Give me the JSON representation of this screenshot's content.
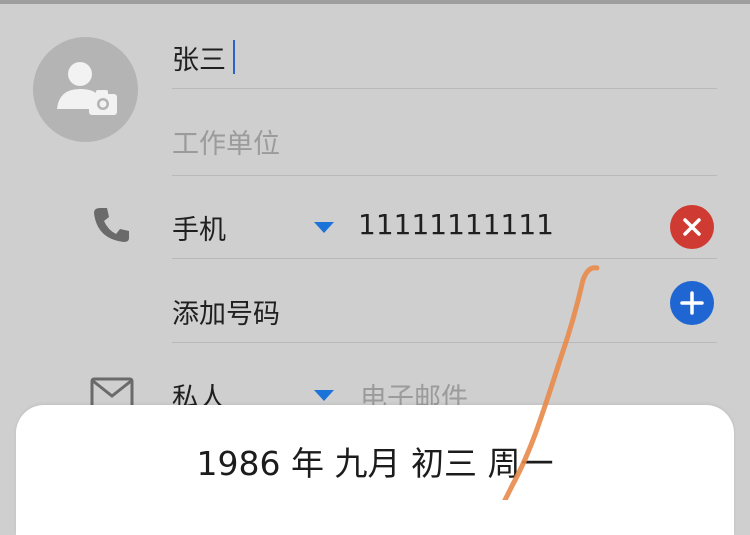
{
  "contact_form": {
    "name_value": "张三",
    "company_placeholder": "工作单位",
    "phone": {
      "type_label": "手机",
      "number": "11111111111"
    },
    "add_number_label": "添加号码",
    "email": {
      "type_label": "私人",
      "placeholder": "电子邮件"
    }
  },
  "date_picker": {
    "year": "1986",
    "year_unit": "年",
    "lunar_month": "九月",
    "lunar_day": "初三",
    "weekday": "周一"
  },
  "icons": {
    "avatar": "person-camera-icon",
    "phone": "phone-icon",
    "email": "mail-icon",
    "clear": "clear-icon",
    "add": "plus-icon",
    "dropdown": "triangle-down-icon"
  },
  "colors": {
    "accent_blue": "#1f66d2",
    "clear_red": "#cf3a32",
    "caret": "#2a64c8",
    "scribble": "#e8894a"
  }
}
